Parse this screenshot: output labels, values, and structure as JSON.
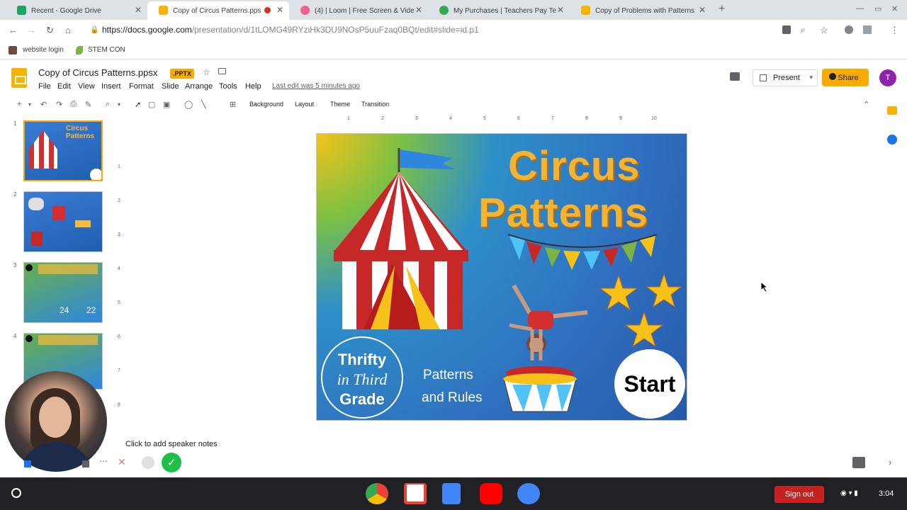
{
  "browser": {
    "tabs": [
      {
        "title": "Recent - Google Drive",
        "active": false
      },
      {
        "title": "Copy of Circus Patterns.pps",
        "active": true
      },
      {
        "title": "(4) | Loom | Free Screen & Vide",
        "active": false
      },
      {
        "title": "My Purchases | Teachers Pay Te",
        "active": false
      },
      {
        "title": "Copy of Problems with Patterns",
        "active": false
      }
    ],
    "new_tab": "+",
    "url_host": "https://docs.google.com",
    "url_path": "/presentation/d/1tLOMG49RYziHk3DU9NOsP5uuFzaq0BQt/edit#slide=id.p1",
    "bookmarks": [
      {
        "label": "website login"
      },
      {
        "label": "STEM CON"
      }
    ]
  },
  "docs": {
    "title": "Copy of Circus Patterns.ppsx",
    "badge": ".PPTX",
    "menu": [
      "File",
      "Edit",
      "View",
      "Insert",
      "Format",
      "Slide",
      "Arrange",
      "Tools",
      "Help"
    ],
    "last_edit": "Last edit was 5 minutes ago",
    "present_label": "Present",
    "share_label": "Share",
    "avatar_initial": "T",
    "toolbar_labels": {
      "background": "Background",
      "layout": "Layout",
      "theme": "Theme",
      "transition": "Transition"
    }
  },
  "filmstrip": {
    "slides": [
      {
        "num": "1",
        "title": "Circus Patterns"
      },
      {
        "num": "2",
        "title": ""
      },
      {
        "num": "3",
        "title": ""
      },
      {
        "num": "4",
        "title": ""
      }
    ]
  },
  "ruler": {
    "ticks": [
      "1",
      "2",
      "3",
      "4",
      "5",
      "6",
      "7",
      "8",
      "9",
      "10"
    ],
    "vticks": [
      "1",
      "2",
      "3",
      "4",
      "5",
      "6",
      "7",
      "8"
    ]
  },
  "slide": {
    "title_line1": "Circus",
    "title_line2": "Patterns",
    "logo_line1": "Thrifty",
    "logo_line2": "in Third",
    "logo_line3": "Grade",
    "subtitle_line1": "Patterns",
    "subtitle_line2": "and Rules",
    "start_label": "Start"
  },
  "thumb3": {
    "n1": "24",
    "n2": "22"
  },
  "speaker_notes": "Click to add speaker notes",
  "shelf": {
    "signout": "Sign out",
    "time": "3:04"
  }
}
